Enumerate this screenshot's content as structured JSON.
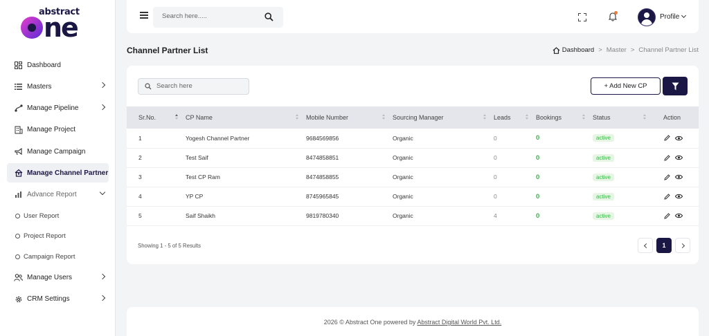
{
  "brand": {
    "line1": "abstract",
    "line2": "ne"
  },
  "sidebar": {
    "items": [
      {
        "label": "Dashboard",
        "icon": "dashboard-icon"
      },
      {
        "label": "Masters",
        "icon": "list-icon"
      },
      {
        "label": "Manage Pipeline",
        "icon": "pipeline-icon"
      },
      {
        "label": "Manage Project",
        "icon": "building-icon"
      },
      {
        "label": "Manage Campaign",
        "icon": "megaphone-icon"
      },
      {
        "label": "Manage Channel Partner",
        "icon": "channel-partner-icon"
      },
      {
        "label": "Advance Report",
        "icon": "chart-icon"
      },
      {
        "label": "Manage Users",
        "icon": "users-icon"
      },
      {
        "label": "CRM Settings",
        "icon": "gear-icon"
      }
    ],
    "report_subitems": [
      "User Report",
      "Project Report",
      "Campaign Report"
    ]
  },
  "topbar": {
    "search_placeholder": "Search here.....",
    "profile_label": "Profile"
  },
  "page": {
    "title": "Channel Partner List",
    "breadcrumb": [
      "Dashboard",
      "Master",
      "Channel Partner List"
    ]
  },
  "toolbar": {
    "search_placeholder": "Search here",
    "add_label": "+ Add New CP"
  },
  "table": {
    "columns": [
      "Sr.No.",
      "CP Name",
      "Mobile Number",
      "Sourcing Manager",
      "Leads",
      "Bookings",
      "Status",
      "Action"
    ],
    "rows": [
      [
        "1",
        "Yogesh Channel Partner",
        "9684569856",
        "Organic",
        "0",
        "0",
        "active"
      ],
      [
        "2",
        "Test Saif",
        "8474858851",
        "Organic",
        "0",
        "0",
        "active"
      ],
      [
        "3",
        "Test CP Ram",
        "8474858855",
        "Organic",
        "0",
        "0",
        "active"
      ],
      [
        "4",
        "YP CP",
        "8745965845",
        "Organic",
        "0",
        "0",
        "active"
      ],
      [
        "5",
        "Saif Shaikh",
        "9819780340",
        "Organic",
        "4",
        "0",
        "active"
      ]
    ]
  },
  "pagination": {
    "summary": "Showing 1 - 5 of 5 Results",
    "current": "1"
  },
  "footer": {
    "text": "2026 © Abstract One powered by",
    "link": "Abstract Digital World Pvt. Ltd."
  },
  "colors": {
    "primary": "#1b1744",
    "success": "#3bb54a",
    "accent": "#e63ec8"
  }
}
